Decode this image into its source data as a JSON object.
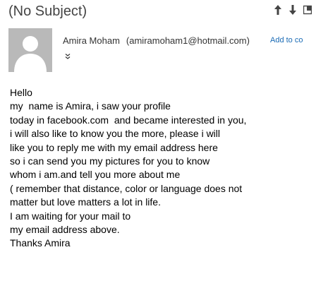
{
  "message": {
    "subject": "(No Subject)",
    "sender_name": "Amira Moham",
    "sender_email": "(amiramoham1@hotmail.com)",
    "add_contact_label": "Add to co"
  },
  "icons": {
    "prev": "arrow-up-icon",
    "next": "arrow-down-icon",
    "expand_window": "new-window-icon",
    "avatar": "person-silhouette-icon",
    "details": "chevron-double-down-icon"
  },
  "colors": {
    "link": "#1a6bb5",
    "avatar_bg": "#b9b9b9",
    "subject_text": "#444444"
  },
  "body": {
    "lines": [
      "Hello",
      "my  name is Amira, i saw your profile",
      "today in facebook.com  and became interested in you,",
      "i will also like to know you the more, please i will",
      "like you to reply me with my email address here",
      "so i can send you my pictures for you to know",
      "whom i am.and tell you more about me",
      "( remember that distance, color or language does not",
      "matter but love matters a lot in life.",
      "I am waiting for your mail to",
      "my email address above.",
      "Thanks Amira"
    ]
  }
}
